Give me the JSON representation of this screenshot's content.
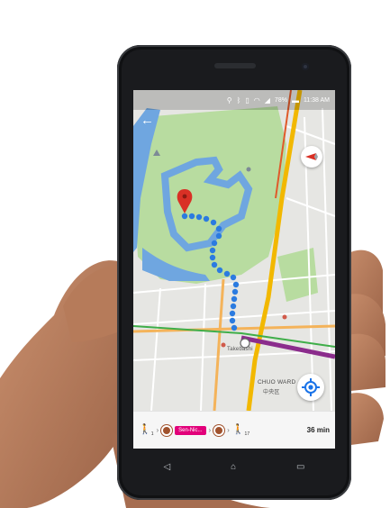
{
  "status_bar": {
    "battery": "78%",
    "time": "11:38 AM",
    "icons": [
      "location-icon",
      "bluetooth-icon",
      "vibrate-icon",
      "wifi-icon",
      "signal-icon",
      "battery-icon"
    ]
  },
  "map": {
    "labels": {
      "chuo_ward_en": "CHUO WARD",
      "chuo_ward_jp": "中央区",
      "station": "Takebashi"
    },
    "colors": {
      "park": "#b8dca0",
      "moat": "#6fa6e0",
      "route": "#2b7be0",
      "pin": "#d93025",
      "highway": "#f2b800",
      "transit_line": "#8b2c8c"
    }
  },
  "directions": {
    "walk_1": "1",
    "line_label": "Sen-Nic...",
    "walk_2": "17",
    "duration": "36 min"
  }
}
